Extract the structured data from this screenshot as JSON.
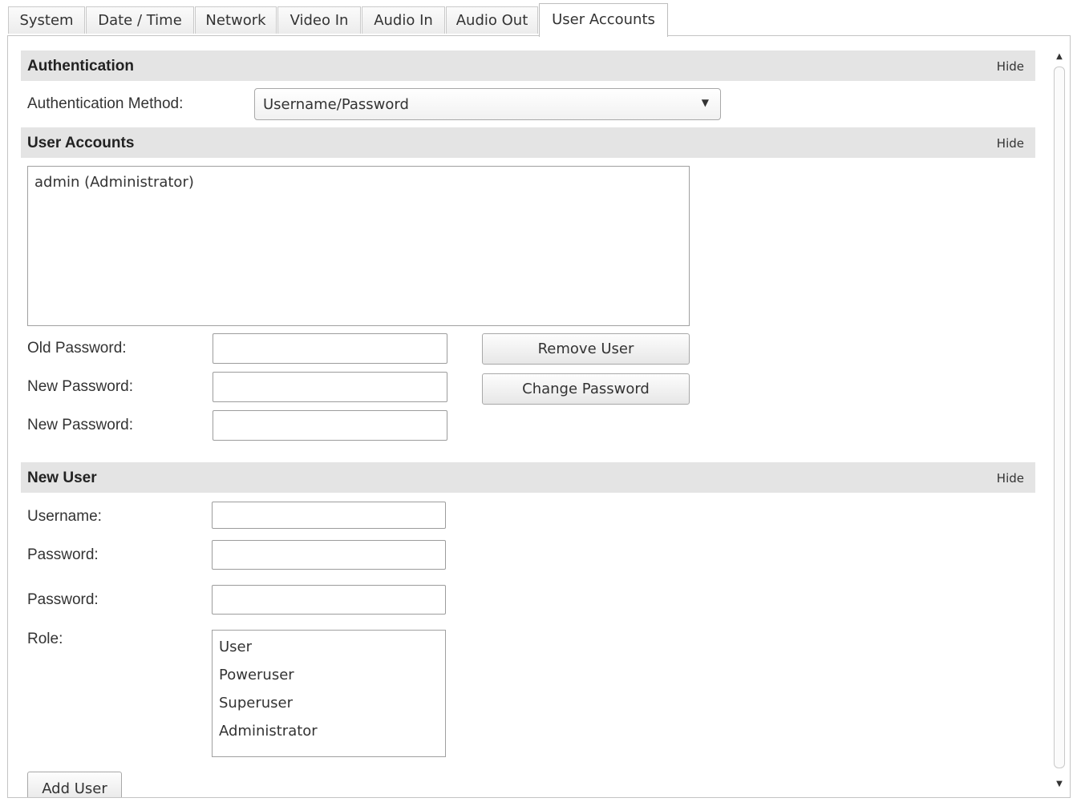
{
  "tabs": [
    {
      "label": "System"
    },
    {
      "label": "Date / Time"
    },
    {
      "label": "Network"
    },
    {
      "label": "Video In"
    },
    {
      "label": "Audio In"
    },
    {
      "label": "Audio Out"
    },
    {
      "label": "User Accounts",
      "active": true
    }
  ],
  "authentication": {
    "title": "Authentication",
    "hide_label": "Hide",
    "method_label": "Authentication Method:",
    "method_value": "Username/Password"
  },
  "user_accounts": {
    "title": "User Accounts",
    "hide_label": "Hide",
    "users": [
      "admin (Administrator)"
    ],
    "old_password_label": "Old Password:",
    "new_password_label": "New Password:",
    "confirm_password_label": "New Password:",
    "remove_user_button": "Remove User",
    "change_password_button": "Change Password"
  },
  "new_user": {
    "title": "New User",
    "hide_label": "Hide",
    "username_label": "Username:",
    "password_label": "Password:",
    "password_confirm_label": "Password:",
    "role_label": "Role:",
    "roles": [
      "User",
      "Poweruser",
      "Superuser",
      "Administrator"
    ],
    "add_user_button": "Add User"
  }
}
